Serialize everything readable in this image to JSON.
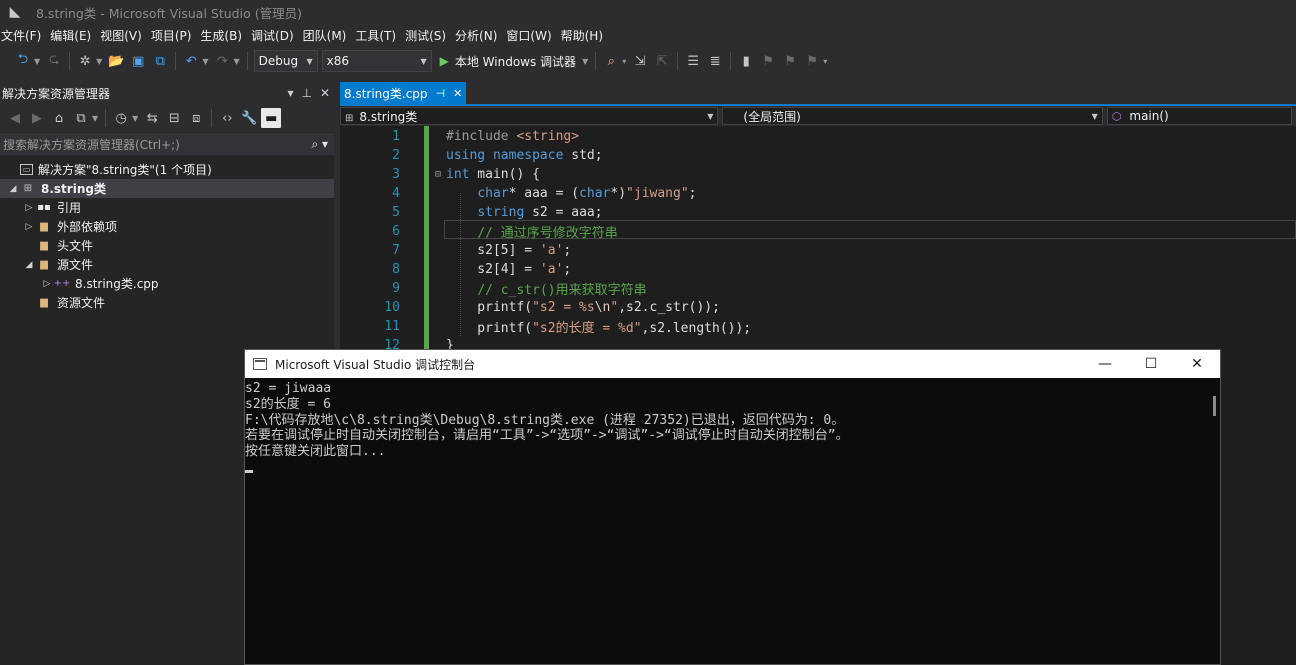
{
  "window": {
    "title": "8.string类 - Microsoft Visual Studio (管理员)"
  },
  "menu": [
    {
      "label": "文件(F)"
    },
    {
      "label": "编辑(E)"
    },
    {
      "label": "视图(V)"
    },
    {
      "label": "项目(P)"
    },
    {
      "label": "生成(B)"
    },
    {
      "label": "调试(D)"
    },
    {
      "label": "团队(M)"
    },
    {
      "label": "工具(T)"
    },
    {
      "label": "测试(S)"
    },
    {
      "label": "分析(N)"
    },
    {
      "label": "窗口(W)"
    },
    {
      "label": "帮助(H)"
    }
  ],
  "toolbar": {
    "config": "Debug",
    "platform": "x86",
    "run_label": "本地 Windows 调试器"
  },
  "solution_explorer": {
    "title": "解决方案资源管理器",
    "search_placeholder": "搜索解决方案资源管理器(Ctrl+;)",
    "items": [
      {
        "label": "解决方案\"8.string类\"(1 个项目)"
      },
      {
        "label": "8.string类"
      },
      {
        "label": "引用"
      },
      {
        "label": "外部依赖项"
      },
      {
        "label": "头文件"
      },
      {
        "label": "源文件"
      },
      {
        "label": "8.string类.cpp"
      },
      {
        "label": "资源文件"
      }
    ]
  },
  "editor": {
    "tab": "8.string类.cpp",
    "nav_project": "8.string类",
    "nav_scope": "(全局范围)",
    "nav_member": "main()",
    "line_numbers": [
      "1",
      "2",
      "3",
      "4",
      "5",
      "6",
      "7",
      "8",
      "9",
      "10",
      "11",
      "12"
    ]
  },
  "console": {
    "title": "Microsoft Visual Studio 调试控制台",
    "lines": [
      "s2 = jiwaaa",
      "s2的长度 = 6",
      "F:\\代码存放地\\c\\8.string类\\Debug\\8.string类.exe (进程 27352)已退出，返回代码为: 0。",
      "若要在调试停止时自动关闭控制台，请启用“工具”->“选项”->“调试”->“调试停止时自动关闭控制台”。",
      "按任意键关闭此窗口..."
    ]
  },
  "colors": {
    "accent": "#007acc",
    "keyword": "#569cd6",
    "string": "#d69d85",
    "comment": "#57a64a",
    "line_number": "#2b91af"
  }
}
